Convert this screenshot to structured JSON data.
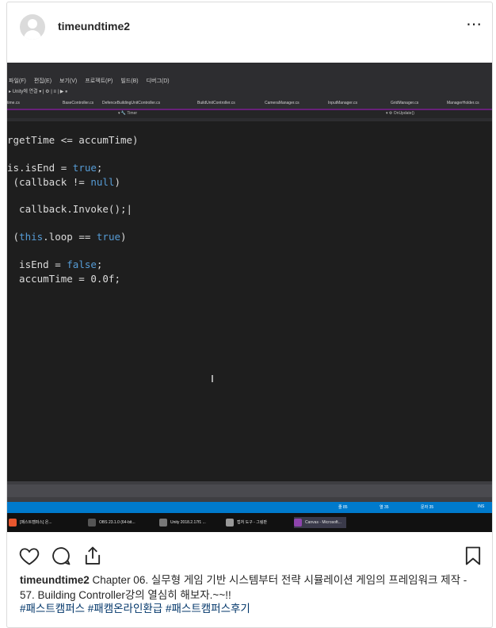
{
  "post": {
    "username": "timeundtime2",
    "more_icon": "⋯",
    "caption_user": "timeundtime2",
    "caption_text": "Chapter 06. 실무형 게임 기반 시스템부터 전략 시뮬레이션 게임의 프레임워크 제작 - 57. Building Controller강의 열심히 해보자.~~!!",
    "hashtags": "#패스트캠퍼스 #패캠온라인환급 #패스트캠퍼스후기"
  },
  "ide": {
    "menu": [
      "파일(F)",
      "편집(E)",
      "보기(V)",
      "프로젝트(P)",
      "빌드(B)",
      "디버그(D)"
    ],
    "toolbar_text": "▸ Unity에 연결 ▾ | ⚙ | ≡ | ▶ ⏸",
    "tabs": [
      "time.cs",
      "BaseController.cs",
      "DefenceBuildingUnitController.cs",
      "BuildUnitController.cs",
      "CameraManager.cs",
      "InputManager.cs",
      "GridManager.cs",
      "ManagerHolder.cs"
    ],
    "nav_left": "▾ 🔧 Timer",
    "nav_right": "▾ ⚙ OnUpdate()",
    "code": [
      {
        "parts": [
          {
            "t": "rgetTime <= accumTime)",
            "k": false
          }
        ]
      },
      {
        "parts": [
          {
            "t": "is.isEnd = ",
            "k": false
          },
          {
            "t": "true",
            "k": true
          },
          {
            "t": ";",
            "k": false
          }
        ]
      },
      {
        "parts": [
          {
            "t": " (callback != ",
            "k": false
          },
          {
            "t": "null",
            "k": true
          },
          {
            "t": ")",
            "k": false
          }
        ]
      },
      {
        "parts": [
          {
            "t": "  callback.Invoke();|",
            "k": false
          }
        ]
      },
      {
        "parts": [
          {
            "t": " (",
            "k": false
          },
          {
            "t": "this",
            "k": true
          },
          {
            "t": ".loop == ",
            "k": false
          },
          {
            "t": "true",
            "k": true
          },
          {
            "t": ")",
            "k": false
          }
        ]
      },
      {
        "parts": [
          {
            "t": "  isEnd = ",
            "k": false
          },
          {
            "t": "false",
            "k": true
          },
          {
            "t": ";",
            "k": false
          }
        ]
      },
      {
        "parts": [
          {
            "t": "  accumTime = 0.0f;",
            "k": false
          }
        ]
      }
    ],
    "status_items": [
      "줄 85",
      "열 35",
      "문자 35",
      "INS"
    ],
    "taskbar": [
      {
        "label": "[패스트캠퍼스] 온...",
        "color": "#e8572e"
      },
      {
        "label": "OBS 23.1.0 (64-bit...",
        "color": "#555555"
      },
      {
        "label": "Unity 2018.2.17f1 ...",
        "color": "#777777"
      },
      {
        "label": "캡처 도구 - 그림판",
        "color": "#999999"
      },
      {
        "label": "Canvas - Microsoft...",
        "color": "#8e44ad"
      }
    ]
  },
  "colors": {
    "accent": "#007acc",
    "tab_underline": "#68217a",
    "keyword": "#569cd6",
    "hashtag": "#003569"
  },
  "icons": [
    "heart-icon",
    "comment-icon",
    "share-icon",
    "bookmark-icon",
    "more-icon"
  ]
}
